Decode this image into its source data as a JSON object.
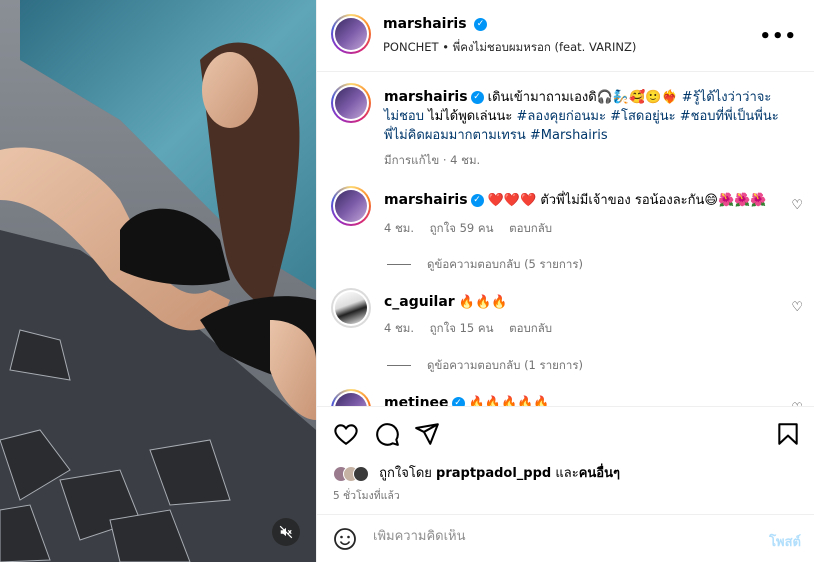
{
  "post": {
    "username": "marshairis",
    "audio": "PONCHET • พี่คงไม่ชอบผมหรอก (feat. VARINZ)",
    "more_label": "•••"
  },
  "caption": {
    "username": "marshairis",
    "text_plain": "เดินเข้ามาถามเองดิ🎧🧞🥰🙂❤️‍🔥 ",
    "tags": "#รู้ได้ไงว่าว่าจะไม่ชอบ",
    "text_plain2": " ไม่ได้พูดเล่นนะ ",
    "tags2": "#ลองคุยก่อนมะ #โสดอยู่นะ #ชอบที่พี่เป็นพี่นะพี่ไม่คิดผอมมากตามเทรน #Marshairis",
    "edited": "มีการแก้ไข · 4 ชม."
  },
  "comments": [
    {
      "username": "marshairis",
      "text": "❤️❤️❤️ ตัวพี่ไม่มีเจ้าของ รอน้องละกัน😄🌺🌺🌺",
      "time": "4 ชม.",
      "likes": "ถูกใจ 59 คน",
      "reply": "ตอบกลับ",
      "view_replies": "ดูข้อความตอบกลับ (5 รายการ)"
    },
    {
      "username": "c_aguilar",
      "text": "🔥🔥🔥",
      "time": "4 ชม.",
      "likes": "ถูกใจ 15 คน",
      "reply": "ตอบกลับ",
      "view_replies": "ดูข้อความตอบกลับ (1 รายการ)"
    },
    {
      "username": "metinee",
      "text": "🔥🔥🔥🔥🔥"
    }
  ],
  "likes": {
    "prefix": "ถูกใจโดย ",
    "user": "praptpadol_ppd",
    "middle": " และ",
    "others": "คนอื่นๆ"
  },
  "time_ago": "5 ชั่วโมงที่แล้ว",
  "add_comment": {
    "placeholder": "เพิ่มความคิดเห็น",
    "post_label": "โพสต์"
  },
  "icons": {
    "mute": "speaker-muted-icon",
    "like": "heart-icon",
    "comment": "comment-bubble-icon",
    "share": "paper-plane-icon",
    "save": "bookmark-icon",
    "emoji": "smiley-icon"
  },
  "colors": {
    "verified": "#0095f6",
    "tag": "#00376b",
    "post_disabled": "#b2dffc",
    "secondary_text": "#737373"
  }
}
